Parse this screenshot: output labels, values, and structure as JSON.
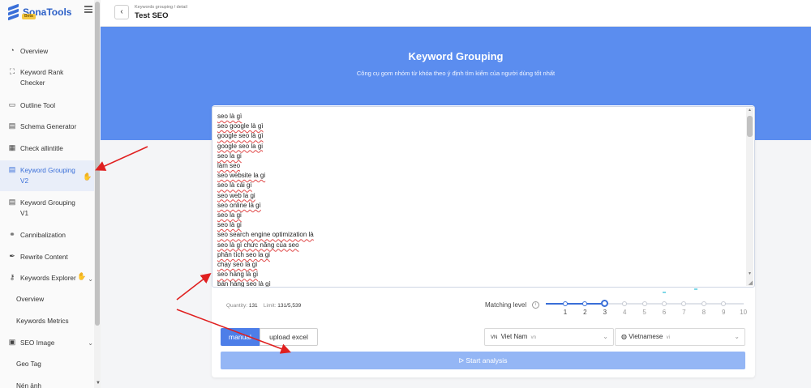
{
  "brand": {
    "name": "SonaTools",
    "badge": "Beta"
  },
  "sidebar": {
    "items": [
      {
        "label": "Overview",
        "icon": "gauge-icon"
      },
      {
        "label": "Keyword Rank Checker",
        "icon": "sitemap-icon"
      },
      {
        "label": "Outline Tool",
        "icon": "outline-icon"
      },
      {
        "label": "Schema Generator",
        "icon": "schema-icon"
      },
      {
        "label": "Check allintitle",
        "icon": "list-icon"
      },
      {
        "label": "Keyword Grouping V2",
        "icon": "file-icon",
        "active": true
      },
      {
        "label": "Keyword Grouping V1",
        "icon": "file-icon"
      },
      {
        "label": "Cannibalization",
        "icon": "network-icon"
      },
      {
        "label": "Rewrite Content",
        "icon": "pen-icon"
      },
      {
        "label": "Keywords Explorer",
        "icon": "key-icon"
      }
    ],
    "explorer_sub": [
      "Overview",
      "Keywords Metrics"
    ],
    "seo_image": {
      "label": "SEO Image",
      "icon": "image-icon",
      "sub": [
        "Geo Tag",
        "Nén ảnh"
      ]
    }
  },
  "header": {
    "breadcrumb": "Keywords grouping / detail",
    "title": "Test SEO",
    "back_icon": "chevron-left-icon"
  },
  "hero": {
    "title": "Keyword Grouping",
    "subtitle": "Công cụ gom nhóm từ khóa theo ý định tìm kiếm của người dùng tốt nhất",
    "background": "#5b8def"
  },
  "keywords": [
    "seo là gì",
    "seo google là gì",
    "google seo là gì",
    "google seo la gi",
    "seo la gi",
    "làm seo",
    "seo website la gi",
    "seo là cái gì",
    "seo web la gi",
    "seo online là gì",
    "seo la gi",
    "seo là gi",
    "seo search engine optimization là",
    "seo là gì chức năng của seo",
    "phân tích seo la gi",
    "chạy seo là gì",
    "seo hàng là gì",
    "bán hàng seo là gì"
  ],
  "stats": {
    "quantity_label": "Quantity:",
    "quantity": "131",
    "limit_label": "Limit:",
    "limit": "131/5,539"
  },
  "matching": {
    "label": "Matching level",
    "value": 3,
    "ticks": [
      "1",
      "2",
      "3",
      "4",
      "5",
      "6",
      "7",
      "8",
      "9",
      "10"
    ]
  },
  "input_mode": {
    "manual": "manual",
    "upload": "upload excel",
    "selected": "manual"
  },
  "country": {
    "value": "Viet Nam",
    "code_prefix": "VN",
    "code_suffix": "vn"
  },
  "language": {
    "value": "Vietnamese",
    "code": "vi",
    "icon": "globe-icon"
  },
  "start_button": "ᐅ Start analysis",
  "accent": "#3a6fd8"
}
